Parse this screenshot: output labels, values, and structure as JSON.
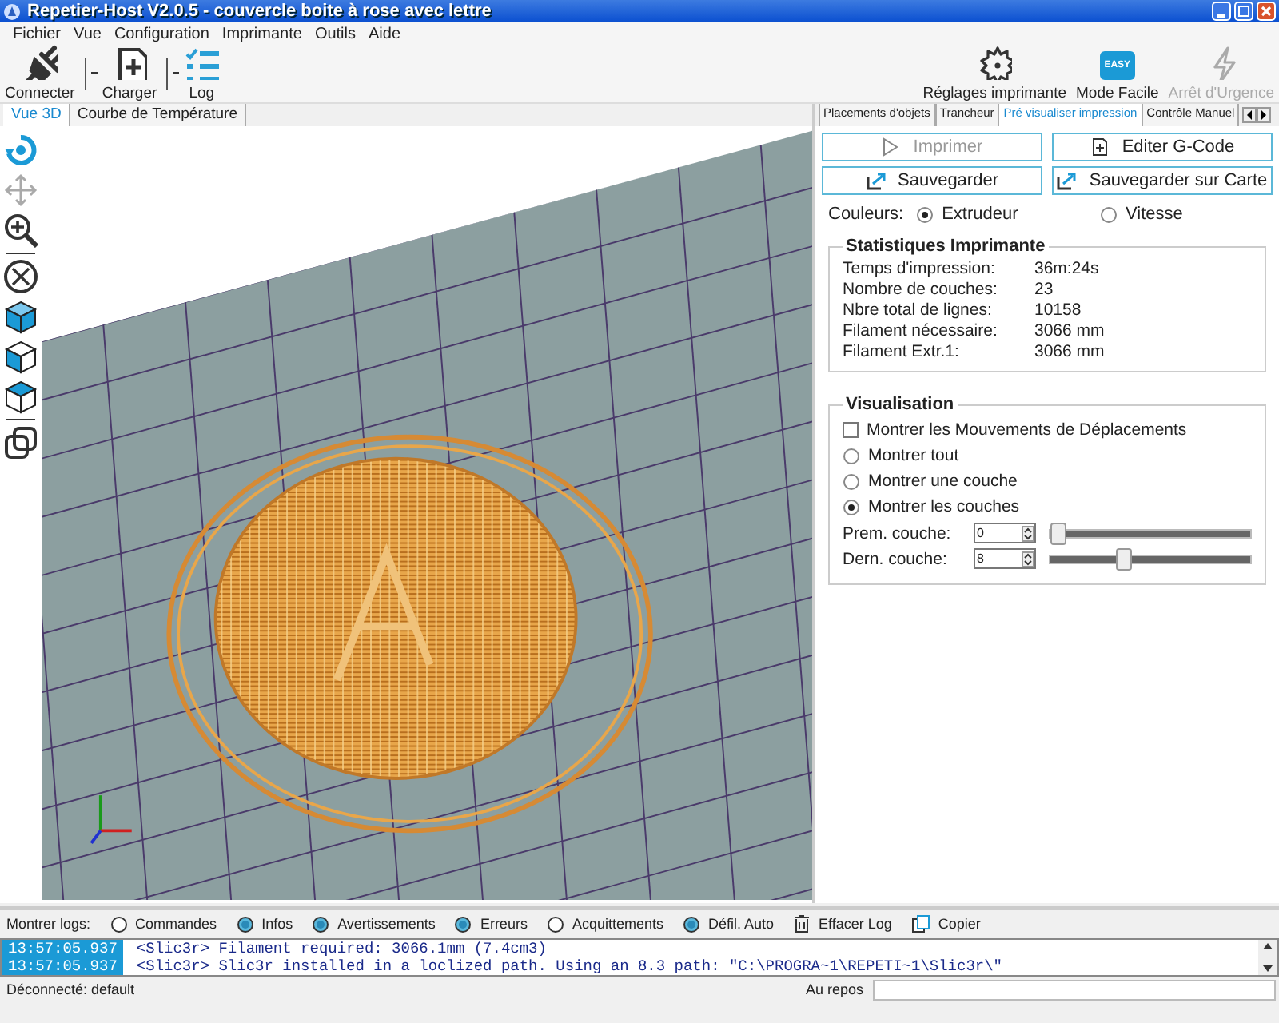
{
  "window": {
    "title": "Repetier-Host V2.0.5 - couvercle boite à rose avec lettre"
  },
  "menu": [
    "Fichier",
    "Vue",
    "Configuration",
    "Imprimante",
    "Outils",
    "Aide"
  ],
  "toolbar": {
    "left": [
      {
        "label": "Connecter",
        "kind": "plug"
      },
      {
        "label": "Charger",
        "kind": "file"
      },
      {
        "label": "Log",
        "kind": "log"
      }
    ],
    "right": [
      {
        "label": "Réglages imprimante",
        "kind": "gear",
        "disabled": false
      },
      {
        "label": "Mode Facile",
        "kind": "easy",
        "badge": "EASY",
        "disabled": false
      },
      {
        "label": "Arrêt d'Urgence",
        "kind": "bolt",
        "disabled": true
      }
    ]
  },
  "view_tabs": [
    {
      "label": "Vue 3D",
      "selected": true
    },
    {
      "label": "Courbe de Température",
      "selected": false
    }
  ],
  "right_tabs": [
    {
      "label": "Placements d'objets",
      "selected": false
    },
    {
      "label": "Trancheur",
      "selected": false
    },
    {
      "label": "Pré visualiser impression",
      "selected": true
    },
    {
      "label": "Contrôle Manuel",
      "selected": false
    }
  ],
  "actions": [
    {
      "label": "Imprimer",
      "kind": "play",
      "disabled": true
    },
    {
      "label": "Editer G-Code",
      "kind": "edit",
      "disabled": false
    },
    {
      "label": "Sauvegarder",
      "kind": "save",
      "disabled": false
    },
    {
      "label": "Sauvegarder sur Carte",
      "kind": "save",
      "disabled": false
    }
  ],
  "colors": {
    "label": "Couleurs:",
    "options": [
      {
        "label": "Extrudeur",
        "selected": true
      },
      {
        "label": "Vitesse",
        "selected": false
      }
    ]
  },
  "stats": {
    "title": "Statistiques Imprimante",
    "rows": [
      {
        "label": "Temps d'impression:",
        "value": "36m:24s"
      },
      {
        "label": "Nombre de couches:",
        "value": "23"
      },
      {
        "label": "Nbre total de lignes:",
        "value": "10158"
      },
      {
        "label": "Filament nécessaire:",
        "value": "3066 mm"
      },
      {
        "label": "Filament Extr.1:",
        "value": "3066 mm"
      }
    ]
  },
  "visualisation": {
    "title": "Visualisation",
    "items": [
      {
        "kind": "checkbox",
        "label": "Montrer les Mouvements de Déplacements",
        "checked": false
      },
      {
        "kind": "radio",
        "label": "Montrer tout",
        "selected": false
      },
      {
        "kind": "radio",
        "label": "Montrer une couche",
        "selected": false
      },
      {
        "kind": "radio",
        "label": "Montrer les couches",
        "selected": true
      }
    ],
    "layers": [
      {
        "label": "Prem. couche:",
        "value": "0",
        "level": 0
      },
      {
        "label": "Dern. couche:",
        "value": "8",
        "level": 0.35
      }
    ]
  },
  "log": {
    "label": "Montrer logs:",
    "filters": [
      {
        "kind": "radio",
        "label": "Commandes",
        "checked": false
      },
      {
        "kind": "radio",
        "label": "Infos",
        "checked": true
      },
      {
        "kind": "radio",
        "label": "Avertissements",
        "checked": true
      },
      {
        "kind": "radio",
        "label": "Erreurs",
        "checked": true
      },
      {
        "kind": "radio",
        "label": "Acquittements",
        "checked": false
      },
      {
        "kind": "radio",
        "label": "Défil. Auto",
        "checked": true
      },
      {
        "kind": "trash",
        "label": "Effacer Log"
      },
      {
        "kind": "copy",
        "label": "Copier"
      }
    ],
    "lines": [
      {
        "time": "13:57:05.937",
        "text": "<Slic3r> Filament required: 3066.1mm (7.4cm3)"
      },
      {
        "time": "13:57:05.937",
        "text": "<Slic3r> Slic3r installed in a loclized path. Using an 8.3 path: \"C:\\PROGRA~1\\REPETI~1\\Slic3r\\\""
      }
    ]
  },
  "status": {
    "left": "Déconnecté: default",
    "right": "Au repos",
    "level": 0
  }
}
